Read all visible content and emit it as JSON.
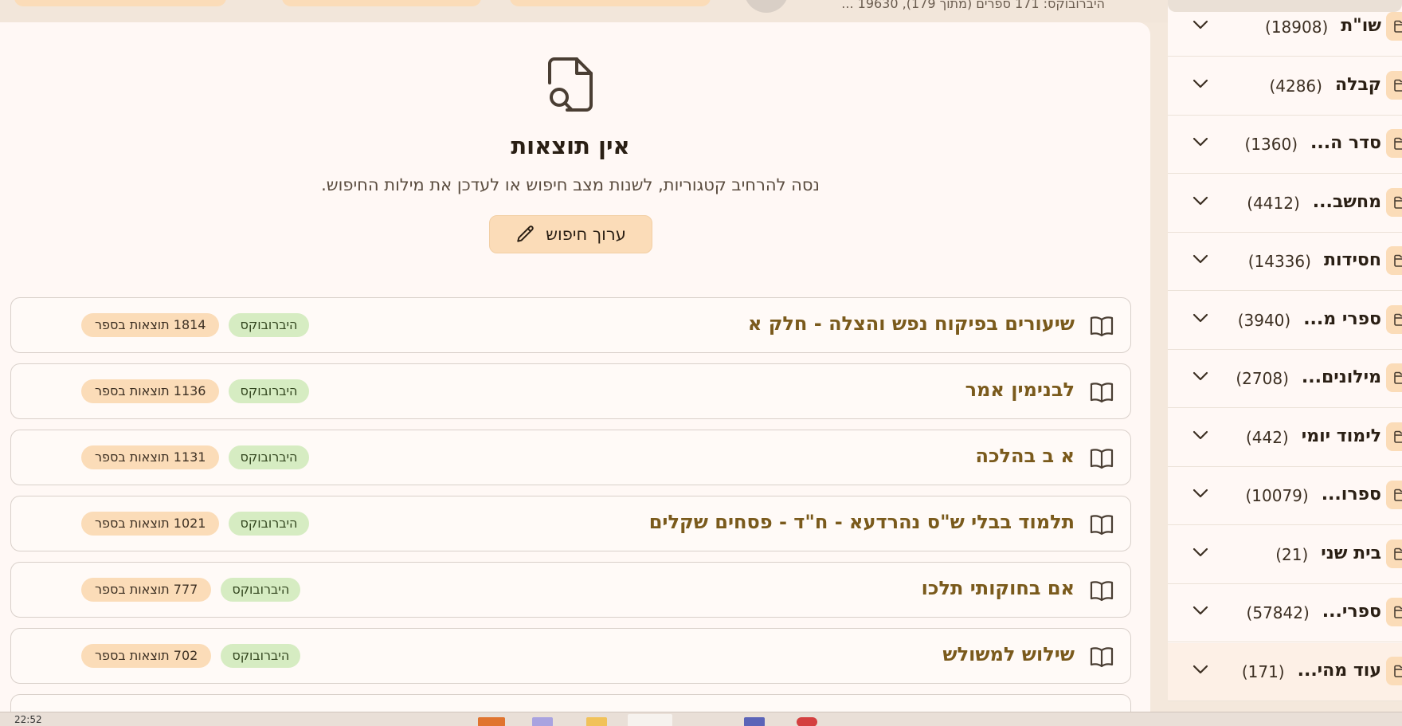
{
  "top": {
    "status_text": "היברובוקס: 171 ספרים (מתוך 179), 19630 ..."
  },
  "empty_state": {
    "icon": "file-search-icon",
    "title": "אין תוצאות",
    "hint": "נסה להרחיב קטגוריות, לשנות מצב חיפוש או לעדכן את מילות החיפוש.",
    "button_label": "ערוך חיפוש",
    "button_icon": "pencil-icon"
  },
  "books": [
    {
      "title": "שיעורים בפיקוח נפש והצלה - חלק א",
      "count": "1814 תוצאות בספר",
      "source": "היברובוקס"
    },
    {
      "title": "לבנימין אמר",
      "count": "1136 תוצאות בספר",
      "source": "היברובוקס"
    },
    {
      "title": "א ב בהלכה",
      "count": "1131 תוצאות בספר",
      "source": "היברובוקס"
    },
    {
      "title": "תלמוד בבלי ש\"ס נהרדעא - ח\"ד - פסחים שקלים",
      "count": "1021 תוצאות בספר",
      "source": "היברובוקס"
    },
    {
      "title": "אם בחוקותי תלכו",
      "count": "777 תוצאות בספר",
      "source": "היברובוקס"
    },
    {
      "title": "שילוש למשולש",
      "count": "702 תוצאות בספר",
      "source": "היברובוקס"
    }
  ],
  "categories": [
    {
      "name": "שו\"ת",
      "count": "(18908)"
    },
    {
      "name": "קבלה",
      "count": "(4286)"
    },
    {
      "name": "סדר ה...",
      "count": "(1360)"
    },
    {
      "name": "מחשב...",
      "count": "(4412)"
    },
    {
      "name": "חסידות",
      "count": "(14336)"
    },
    {
      "name": "ספרי מ...",
      "count": "(3940)"
    },
    {
      "name": "מילונים...",
      "count": "(2708)"
    },
    {
      "name": "לימוד יומי",
      "count": "(442)"
    },
    {
      "name": "ספרו...",
      "count": "(10079)"
    },
    {
      "name": "בית שני",
      "count": "(21)"
    },
    {
      "name": "ספרי...",
      "count": "(57842)"
    },
    {
      "name": "עוד מהי...",
      "count": "(171)"
    }
  ],
  "taskbar": {
    "clock": "22:52"
  },
  "colors": {
    "accent": "#fbdcb8",
    "source_badge": "#d6ecc2",
    "book_title": "#7a5a1c"
  }
}
